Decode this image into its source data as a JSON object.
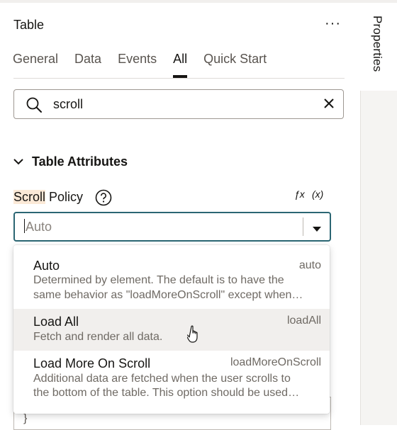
{
  "panel": {
    "title": "Table",
    "more": "···",
    "side_tab": "Properties"
  },
  "tabs": [
    {
      "label": "General",
      "active": false
    },
    {
      "label": "Data",
      "active": false
    },
    {
      "label": "Events",
      "active": false
    },
    {
      "label": "All",
      "active": true
    },
    {
      "label": "Quick Start",
      "active": false
    }
  ],
  "search": {
    "value": "scroll"
  },
  "section": {
    "label": "Table Attributes",
    "expanded": true
  },
  "field": {
    "label_highlight": "Scroll",
    "label_rest": " Policy",
    "fx": "ƒx",
    "expr": "(x)",
    "placeholder": "Auto"
  },
  "options": [
    {
      "title": "Auto",
      "value": "auto",
      "desc1": "Determined by element. The default is to have the",
      "desc2": "same behavior as \"loadMoreOnScroll\" except when…"
    },
    {
      "title": "Load All",
      "value": "loadAll",
      "desc1": "Fetch and render all data.",
      "desc2": ""
    },
    {
      "title": "Load More On Scroll",
      "value": "loadMoreOnScroll",
      "desc1": "Additional data are fetched when the user scrolls to",
      "desc2": "the bottom of the table. This option should be used…"
    }
  ],
  "under": {
    "brace": "}"
  },
  "icons": [
    "search-icon",
    "clear-icon",
    "chevron-down-icon",
    "help-icon",
    "dropdown-arrow-icon",
    "hand-cursor-icon"
  ]
}
